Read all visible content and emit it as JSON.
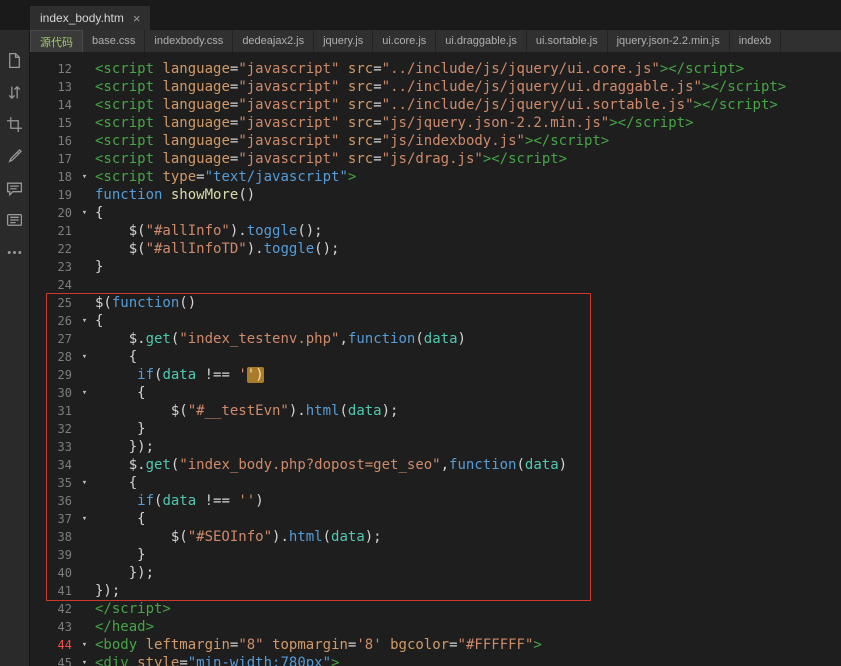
{
  "window": {
    "tab_title": "index_body.htm",
    "tab_close": "×"
  },
  "related_files": {
    "active": "源代码",
    "items": [
      "源代码",
      "base.css",
      "indexbody.css",
      "dedeajax2.js",
      "jquery.js",
      "ui.core.js",
      "ui.draggable.js",
      "ui.sortable.js",
      "jquery.json-2.2.min.js",
      "indexb"
    ]
  },
  "sidebar": {
    "icons": [
      "new-file-icon",
      "sort-lines-icon",
      "crop-tool-icon",
      "format-brush-icon",
      "comment-icon",
      "comment-block-icon",
      "more-icon"
    ]
  },
  "colors": {
    "tag": "#46a546",
    "attr": "#d19a66",
    "str": "#cf8a6a",
    "strb": "#569cd6",
    "kw": "#569cd6",
    "fn": "#dcdcaa",
    "mth": "#569cd6",
    "mth2": "#4ec9b0",
    "par": "#4ec9b0",
    "pl": "#d4d4d4",
    "hl_bg": "#a87b2d",
    "hl_text": "#ffe1a8",
    "ln": "#7d7d7d",
    "ln_red": "#f14c4c",
    "fold": "#b9b9b9",
    "active_file": "#a3c969",
    "annotation": "#cc392c"
  },
  "editor": {
    "lines": [
      {
        "no": 12,
        "tokens": [
          [
            "tag",
            "<script"
          ],
          [
            "pl",
            " "
          ],
          [
            "attr",
            "language"
          ],
          [
            "pl",
            "="
          ],
          [
            "str",
            "\"javascript\""
          ],
          [
            "pl",
            " "
          ],
          [
            "attr",
            "src"
          ],
          [
            "pl",
            "="
          ],
          [
            "str",
            "\"../include/js/jquery/ui.core.js\""
          ],
          [
            "tag",
            "></script>"
          ]
        ]
      },
      {
        "no": 13,
        "tokens": [
          [
            "tag",
            "<script"
          ],
          [
            "pl",
            " "
          ],
          [
            "attr",
            "language"
          ],
          [
            "pl",
            "="
          ],
          [
            "str",
            "\"javascript\""
          ],
          [
            "pl",
            " "
          ],
          [
            "attr",
            "src"
          ],
          [
            "pl",
            "="
          ],
          [
            "str",
            "\"../include/js/jquery/ui.draggable.js\""
          ],
          [
            "tag",
            "></script>"
          ]
        ]
      },
      {
        "no": 14,
        "tokens": [
          [
            "tag",
            "<script"
          ],
          [
            "pl",
            " "
          ],
          [
            "attr",
            "language"
          ],
          [
            "pl",
            "="
          ],
          [
            "str",
            "\"javascript\""
          ],
          [
            "pl",
            " "
          ],
          [
            "attr",
            "src"
          ],
          [
            "pl",
            "="
          ],
          [
            "str",
            "\"../include/js/jquery/ui.sortable.js\""
          ],
          [
            "tag",
            "></script>"
          ]
        ]
      },
      {
        "no": 15,
        "tokens": [
          [
            "tag",
            "<script"
          ],
          [
            "pl",
            " "
          ],
          [
            "attr",
            "language"
          ],
          [
            "pl",
            "="
          ],
          [
            "str",
            "\"javascript\""
          ],
          [
            "pl",
            " "
          ],
          [
            "attr",
            "src"
          ],
          [
            "pl",
            "="
          ],
          [
            "str",
            "\"js/jquery.json-2.2.min.js\""
          ],
          [
            "tag",
            "></script>"
          ]
        ]
      },
      {
        "no": 16,
        "tokens": [
          [
            "tag",
            "<script"
          ],
          [
            "pl",
            " "
          ],
          [
            "attr",
            "language"
          ],
          [
            "pl",
            "="
          ],
          [
            "str",
            "\"javascript\""
          ],
          [
            "pl",
            " "
          ],
          [
            "attr",
            "src"
          ],
          [
            "pl",
            "="
          ],
          [
            "str",
            "\"js/indexbody.js\""
          ],
          [
            "tag",
            "></script>"
          ]
        ]
      },
      {
        "no": 17,
        "tokens": [
          [
            "tag",
            "<script"
          ],
          [
            "pl",
            " "
          ],
          [
            "attr",
            "language"
          ],
          [
            "pl",
            "="
          ],
          [
            "str",
            "\"javascript\""
          ],
          [
            "pl",
            " "
          ],
          [
            "attr",
            "src"
          ],
          [
            "pl",
            "="
          ],
          [
            "str",
            "\"js/drag.js\""
          ],
          [
            "tag",
            "></script>"
          ]
        ]
      },
      {
        "no": 18,
        "fold": true,
        "tokens": [
          [
            "tag",
            "<script"
          ],
          [
            "pl",
            " "
          ],
          [
            "attr",
            "type"
          ],
          [
            "pl",
            "="
          ],
          [
            "strb",
            "\"text/javascript\""
          ],
          [
            "tag",
            ">"
          ]
        ]
      },
      {
        "no": 19,
        "tokens": [
          [
            "kw",
            "function"
          ],
          [
            "pl",
            " "
          ],
          [
            "fn",
            "showMore"
          ],
          [
            "pl",
            "()"
          ]
        ]
      },
      {
        "no": 20,
        "fold": true,
        "tokens": [
          [
            "pl",
            "{"
          ]
        ]
      },
      {
        "no": 21,
        "tokens": [
          [
            "pl",
            "    $("
          ],
          [
            "str",
            "\"#allInfo\""
          ],
          [
            "pl",
            ")."
          ],
          [
            "mth",
            "toggle"
          ],
          [
            "pl",
            "();"
          ]
        ]
      },
      {
        "no": 22,
        "tokens": [
          [
            "pl",
            "    $("
          ],
          [
            "str",
            "\"#allInfoTD\""
          ],
          [
            "pl",
            ")."
          ],
          [
            "mth",
            "toggle"
          ],
          [
            "pl",
            "();"
          ]
        ]
      },
      {
        "no": 23,
        "tokens": [
          [
            "pl",
            "}"
          ]
        ]
      },
      {
        "no": 24,
        "tokens": []
      },
      {
        "no": 25,
        "tokens": [
          [
            "pl",
            "$("
          ],
          [
            "kw",
            "function"
          ],
          [
            "pl",
            "()"
          ]
        ]
      },
      {
        "no": 26,
        "fold": true,
        "tokens": [
          [
            "pl",
            "{"
          ]
        ]
      },
      {
        "no": 27,
        "tokens": [
          [
            "pl",
            "    $."
          ],
          [
            "mth2",
            "get"
          ],
          [
            "pl",
            "("
          ],
          [
            "str",
            "\"index_testenv.php\""
          ],
          [
            "pl",
            ","
          ],
          [
            "kw",
            "function"
          ],
          [
            "pl",
            "("
          ],
          [
            "par",
            "data"
          ],
          [
            "pl",
            ")"
          ]
        ]
      },
      {
        "no": 28,
        "fold": true,
        "tokens": [
          [
            "pl",
            "    {"
          ]
        ]
      },
      {
        "no": 29,
        "tokens": [
          [
            "pl",
            "     "
          ],
          [
            "kw",
            "if"
          ],
          [
            "pl",
            "("
          ],
          [
            "par",
            "data"
          ],
          [
            "pl",
            " !== "
          ],
          [
            "str",
            "'"
          ],
          [
            "hl",
            "')"
          ]
        ]
      },
      {
        "no": 30,
        "fold": true,
        "tokens": [
          [
            "pl",
            "     {"
          ]
        ]
      },
      {
        "no": 31,
        "tokens": [
          [
            "pl",
            "         $("
          ],
          [
            "str",
            "\"#__testEvn\""
          ],
          [
            "pl",
            ")."
          ],
          [
            "mth",
            "html"
          ],
          [
            "pl",
            "("
          ],
          [
            "par",
            "data"
          ],
          [
            "pl",
            ");"
          ]
        ]
      },
      {
        "no": 32,
        "tokens": [
          [
            "pl",
            "     }"
          ]
        ]
      },
      {
        "no": 33,
        "tokens": [
          [
            "pl",
            "    });"
          ]
        ]
      },
      {
        "no": 34,
        "tokens": [
          [
            "pl",
            "    $."
          ],
          [
            "mth2",
            "get"
          ],
          [
            "pl",
            "("
          ],
          [
            "str",
            "\"index_body.php?dopost=get_seo\""
          ],
          [
            "pl",
            ","
          ],
          [
            "kw",
            "function"
          ],
          [
            "pl",
            "("
          ],
          [
            "par",
            "data"
          ],
          [
            "pl",
            ")"
          ]
        ]
      },
      {
        "no": 35,
        "fold": true,
        "tokens": [
          [
            "pl",
            "    {"
          ]
        ]
      },
      {
        "no": 36,
        "tokens": [
          [
            "pl",
            "     "
          ],
          [
            "kw",
            "if"
          ],
          [
            "pl",
            "("
          ],
          [
            "par",
            "data"
          ],
          [
            "pl",
            " !== "
          ],
          [
            "str",
            "''"
          ],
          [
            "pl",
            ")"
          ]
        ]
      },
      {
        "no": 37,
        "fold": true,
        "tokens": [
          [
            "pl",
            "     {"
          ]
        ]
      },
      {
        "no": 38,
        "tokens": [
          [
            "pl",
            "         $("
          ],
          [
            "str",
            "\"#SEOInfo\""
          ],
          [
            "pl",
            ")."
          ],
          [
            "mth",
            "html"
          ],
          [
            "pl",
            "("
          ],
          [
            "par",
            "data"
          ],
          [
            "pl",
            ");"
          ]
        ]
      },
      {
        "no": 39,
        "tokens": [
          [
            "pl",
            "     }"
          ]
        ]
      },
      {
        "no": 40,
        "tokens": [
          [
            "pl",
            "    });"
          ]
        ]
      },
      {
        "no": 41,
        "tokens": [
          [
            "pl",
            "});"
          ]
        ]
      },
      {
        "no": 42,
        "tokens": [
          [
            "tag",
            "</script>"
          ]
        ]
      },
      {
        "no": 43,
        "tokens": [
          [
            "tag",
            "</head>"
          ]
        ]
      },
      {
        "no": 44,
        "fold": true,
        "red": true,
        "tokens": [
          [
            "tag",
            "<body"
          ],
          [
            "pl",
            " "
          ],
          [
            "attr",
            "leftmargin"
          ],
          [
            "pl",
            "="
          ],
          [
            "str",
            "\"8\""
          ],
          [
            "pl",
            " "
          ],
          [
            "attr",
            "topmargin"
          ],
          [
            "pl",
            "="
          ],
          [
            "str",
            "'8'"
          ],
          [
            "pl",
            " "
          ],
          [
            "attr",
            "bgcolor"
          ],
          [
            "pl",
            "="
          ],
          [
            "str",
            "\"#FFFFFF\""
          ],
          [
            "tag",
            ">"
          ]
        ]
      },
      {
        "no": 45,
        "fold": true,
        "tokens": [
          [
            "tag",
            "<div"
          ],
          [
            "pl",
            " "
          ],
          [
            "attr",
            "style"
          ],
          [
            "pl",
            "="
          ],
          [
            "strb",
            "\"min-width:780px\""
          ],
          [
            "tag",
            ">"
          ]
        ]
      }
    ],
    "annotation_covers_lines": "25-41"
  }
}
